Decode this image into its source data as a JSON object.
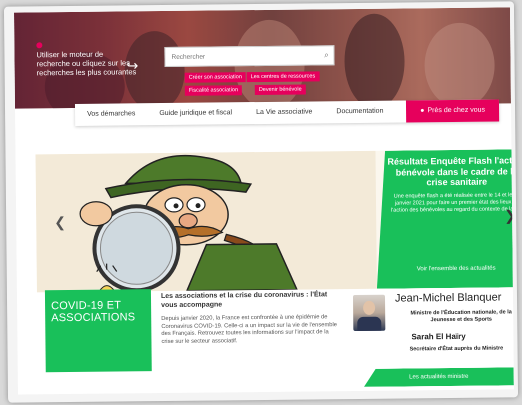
{
  "hero": {
    "prompt_text": "Utiliser le moteur de recherche ou cliquez sur les recherches les plus courantes"
  },
  "search": {
    "placeholder": "Rechercher"
  },
  "quick_tags": [
    {
      "label": "Créer son association"
    },
    {
      "label": "Les centres de ressources"
    },
    {
      "label": "Fiscalité association"
    },
    {
      "label": "Devenir bénévole"
    }
  ],
  "nav": {
    "items": [
      {
        "label": "Vos démarches"
      },
      {
        "label": "Guide juridique et fiscal"
      },
      {
        "label": "La Vie associative"
      },
      {
        "label": "Documentation"
      }
    ],
    "nearby_label": "Près de chez vous"
  },
  "carousel": {
    "title": "Résultats Enquête Flash l'action bénévole dans le cadre de la crise sanitaire",
    "summary": "Une enquête flash a été réalisée entre le 14 et le 21 janvier 2021 pour faire un premier état des lieux de l'action des bénévoles au regard du contexte de la (...)",
    "all_news_link": "Voir l'ensemble des actualités"
  },
  "covid": {
    "label": "COVID-19 ET ASSOCIATIONS"
  },
  "article": {
    "title": "Les associations et la crise du coronavirus : l'État vous accompagne",
    "body": "Depuis janvier 2020, la France est confrontée à une épidémie de Coronavirus COVID-19. Celle-ci a un impact sur la vie de l'ensemble des Français. Retrouvez toutes les informations sur l'impact de la crise sur le secteur associatif."
  },
  "minister": {
    "name": "Jean-Michel Blanquer",
    "role": "Ministre de l'Éducation nationale, de la Jeunesse et des Sports",
    "secretary_name": "Sarah El Haïry",
    "secretary_role": "Secrétaire d'État auprès du Ministre",
    "news_link": "Les actualités ministre"
  },
  "colors": {
    "accent_pink": "#e6005c",
    "accent_green": "#19c05a"
  }
}
